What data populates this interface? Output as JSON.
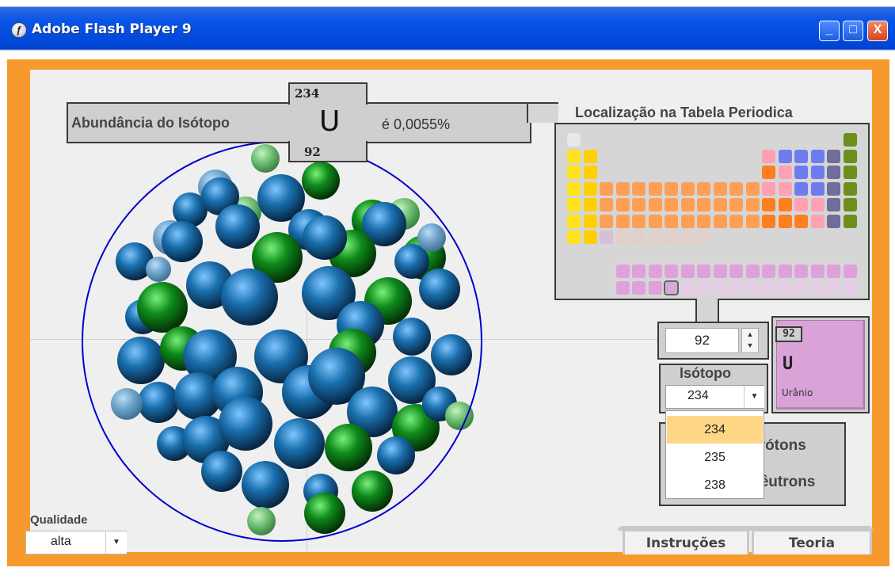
{
  "window": {
    "title": "Adobe Flash Player 9",
    "minimize": "_",
    "maximize": "□",
    "close": "X"
  },
  "abundance": {
    "label": "Abundância do Isótopo",
    "mass_number": "234",
    "symbol": "U",
    "atomic_number": "92",
    "value_text": "é 0,0055%"
  },
  "periodic_table": {
    "title": "Localização na Tabela Periodica"
  },
  "atomic_number_input": {
    "value": "92",
    "spinner": "▲\n▼"
  },
  "element_tile": {
    "atomic_number": "92",
    "symbol": "U",
    "name": "Urânio",
    "color": "#d9a3d8"
  },
  "isotope": {
    "label": "Isótopo",
    "selected": "234",
    "arrow": "▼",
    "options": [
      "234",
      "235",
      "238"
    ],
    "highlighted_option": "234"
  },
  "particles": {
    "protons_label": "Prótons",
    "neutrons_label": "Nêutrons"
  },
  "quality": {
    "label": "Qualidade",
    "selected": "alta",
    "arrow": "▼"
  },
  "tabs": [
    {
      "label": "Instruções"
    },
    {
      "label": "Teoria"
    }
  ],
  "colors": {
    "frame": "#f79a2e",
    "proton": "#1a6fae",
    "neutron": "#0e8a1a",
    "nucleus_ring": "#0000cc",
    "dropdown_highlight": "#fdd686"
  }
}
